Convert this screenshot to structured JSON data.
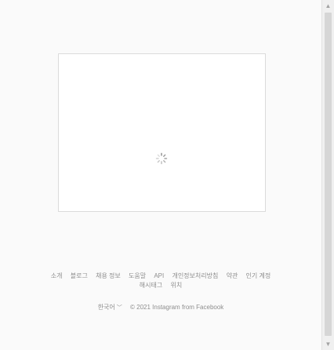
{
  "footer": {
    "links": [
      "소개",
      "블로그",
      "채용 정보",
      "도움말",
      "API",
      "개인정보처리방침",
      "약관",
      "인기 계정",
      "해시태그",
      "위치"
    ],
    "language": "한국어",
    "copyright": "© 2021 Instagram from Facebook"
  },
  "icons": {
    "spinner": "loading-spinner-icon",
    "language_dropdown": "chevron-down-icon",
    "scroll_up": "scroll-up-arrow-icon",
    "scroll_down": "scroll-down-arrow-icon"
  },
  "colors": {
    "page_background": "#fafafa",
    "panel_background": "#ffffff",
    "panel_border": "#dbdbdb",
    "footer_text": "#8e8e8e",
    "spinner": "#8e8e8e"
  }
}
